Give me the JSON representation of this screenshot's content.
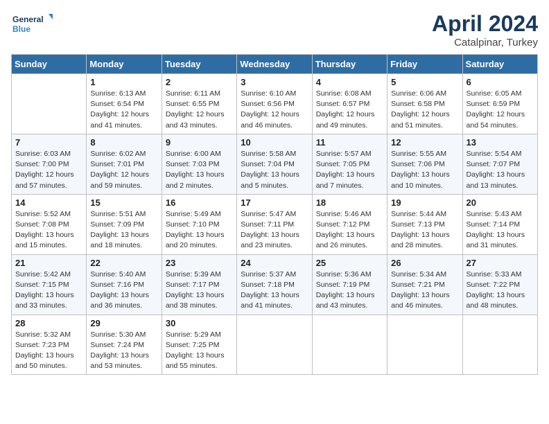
{
  "header": {
    "logo_line1": "General",
    "logo_line2": "Blue",
    "month_title": "April 2024",
    "location": "Catalpinar, Turkey"
  },
  "columns": [
    "Sunday",
    "Monday",
    "Tuesday",
    "Wednesday",
    "Thursday",
    "Friday",
    "Saturday"
  ],
  "weeks": [
    [
      {
        "day": "",
        "info": ""
      },
      {
        "day": "1",
        "info": "Sunrise: 6:13 AM\nSunset: 6:54 PM\nDaylight: 12 hours\nand 41 minutes."
      },
      {
        "day": "2",
        "info": "Sunrise: 6:11 AM\nSunset: 6:55 PM\nDaylight: 12 hours\nand 43 minutes."
      },
      {
        "day": "3",
        "info": "Sunrise: 6:10 AM\nSunset: 6:56 PM\nDaylight: 12 hours\nand 46 minutes."
      },
      {
        "day": "4",
        "info": "Sunrise: 6:08 AM\nSunset: 6:57 PM\nDaylight: 12 hours\nand 49 minutes."
      },
      {
        "day": "5",
        "info": "Sunrise: 6:06 AM\nSunset: 6:58 PM\nDaylight: 12 hours\nand 51 minutes."
      },
      {
        "day": "6",
        "info": "Sunrise: 6:05 AM\nSunset: 6:59 PM\nDaylight: 12 hours\nand 54 minutes."
      }
    ],
    [
      {
        "day": "7",
        "info": "Sunrise: 6:03 AM\nSunset: 7:00 PM\nDaylight: 12 hours\nand 57 minutes."
      },
      {
        "day": "8",
        "info": "Sunrise: 6:02 AM\nSunset: 7:01 PM\nDaylight: 12 hours\nand 59 minutes."
      },
      {
        "day": "9",
        "info": "Sunrise: 6:00 AM\nSunset: 7:03 PM\nDaylight: 13 hours\nand 2 minutes."
      },
      {
        "day": "10",
        "info": "Sunrise: 5:58 AM\nSunset: 7:04 PM\nDaylight: 13 hours\nand 5 minutes."
      },
      {
        "day": "11",
        "info": "Sunrise: 5:57 AM\nSunset: 7:05 PM\nDaylight: 13 hours\nand 7 minutes."
      },
      {
        "day": "12",
        "info": "Sunrise: 5:55 AM\nSunset: 7:06 PM\nDaylight: 13 hours\nand 10 minutes."
      },
      {
        "day": "13",
        "info": "Sunrise: 5:54 AM\nSunset: 7:07 PM\nDaylight: 13 hours\nand 13 minutes."
      }
    ],
    [
      {
        "day": "14",
        "info": "Sunrise: 5:52 AM\nSunset: 7:08 PM\nDaylight: 13 hours\nand 15 minutes."
      },
      {
        "day": "15",
        "info": "Sunrise: 5:51 AM\nSunset: 7:09 PM\nDaylight: 13 hours\nand 18 minutes."
      },
      {
        "day": "16",
        "info": "Sunrise: 5:49 AM\nSunset: 7:10 PM\nDaylight: 13 hours\nand 20 minutes."
      },
      {
        "day": "17",
        "info": "Sunrise: 5:47 AM\nSunset: 7:11 PM\nDaylight: 13 hours\nand 23 minutes."
      },
      {
        "day": "18",
        "info": "Sunrise: 5:46 AM\nSunset: 7:12 PM\nDaylight: 13 hours\nand 26 minutes."
      },
      {
        "day": "19",
        "info": "Sunrise: 5:44 AM\nSunset: 7:13 PM\nDaylight: 13 hours\nand 28 minutes."
      },
      {
        "day": "20",
        "info": "Sunrise: 5:43 AM\nSunset: 7:14 PM\nDaylight: 13 hours\nand 31 minutes."
      }
    ],
    [
      {
        "day": "21",
        "info": "Sunrise: 5:42 AM\nSunset: 7:15 PM\nDaylight: 13 hours\nand 33 minutes."
      },
      {
        "day": "22",
        "info": "Sunrise: 5:40 AM\nSunset: 7:16 PM\nDaylight: 13 hours\nand 36 minutes."
      },
      {
        "day": "23",
        "info": "Sunrise: 5:39 AM\nSunset: 7:17 PM\nDaylight: 13 hours\nand 38 minutes."
      },
      {
        "day": "24",
        "info": "Sunrise: 5:37 AM\nSunset: 7:18 PM\nDaylight: 13 hours\nand 41 minutes."
      },
      {
        "day": "25",
        "info": "Sunrise: 5:36 AM\nSunset: 7:19 PM\nDaylight: 13 hours\nand 43 minutes."
      },
      {
        "day": "26",
        "info": "Sunrise: 5:34 AM\nSunset: 7:21 PM\nDaylight: 13 hours\nand 46 minutes."
      },
      {
        "day": "27",
        "info": "Sunrise: 5:33 AM\nSunset: 7:22 PM\nDaylight: 13 hours\nand 48 minutes."
      }
    ],
    [
      {
        "day": "28",
        "info": "Sunrise: 5:32 AM\nSunset: 7:23 PM\nDaylight: 13 hours\nand 50 minutes."
      },
      {
        "day": "29",
        "info": "Sunrise: 5:30 AM\nSunset: 7:24 PM\nDaylight: 13 hours\nand 53 minutes."
      },
      {
        "day": "30",
        "info": "Sunrise: 5:29 AM\nSunset: 7:25 PM\nDaylight: 13 hours\nand 55 minutes."
      },
      {
        "day": "",
        "info": ""
      },
      {
        "day": "",
        "info": ""
      },
      {
        "day": "",
        "info": ""
      },
      {
        "day": "",
        "info": ""
      }
    ]
  ]
}
